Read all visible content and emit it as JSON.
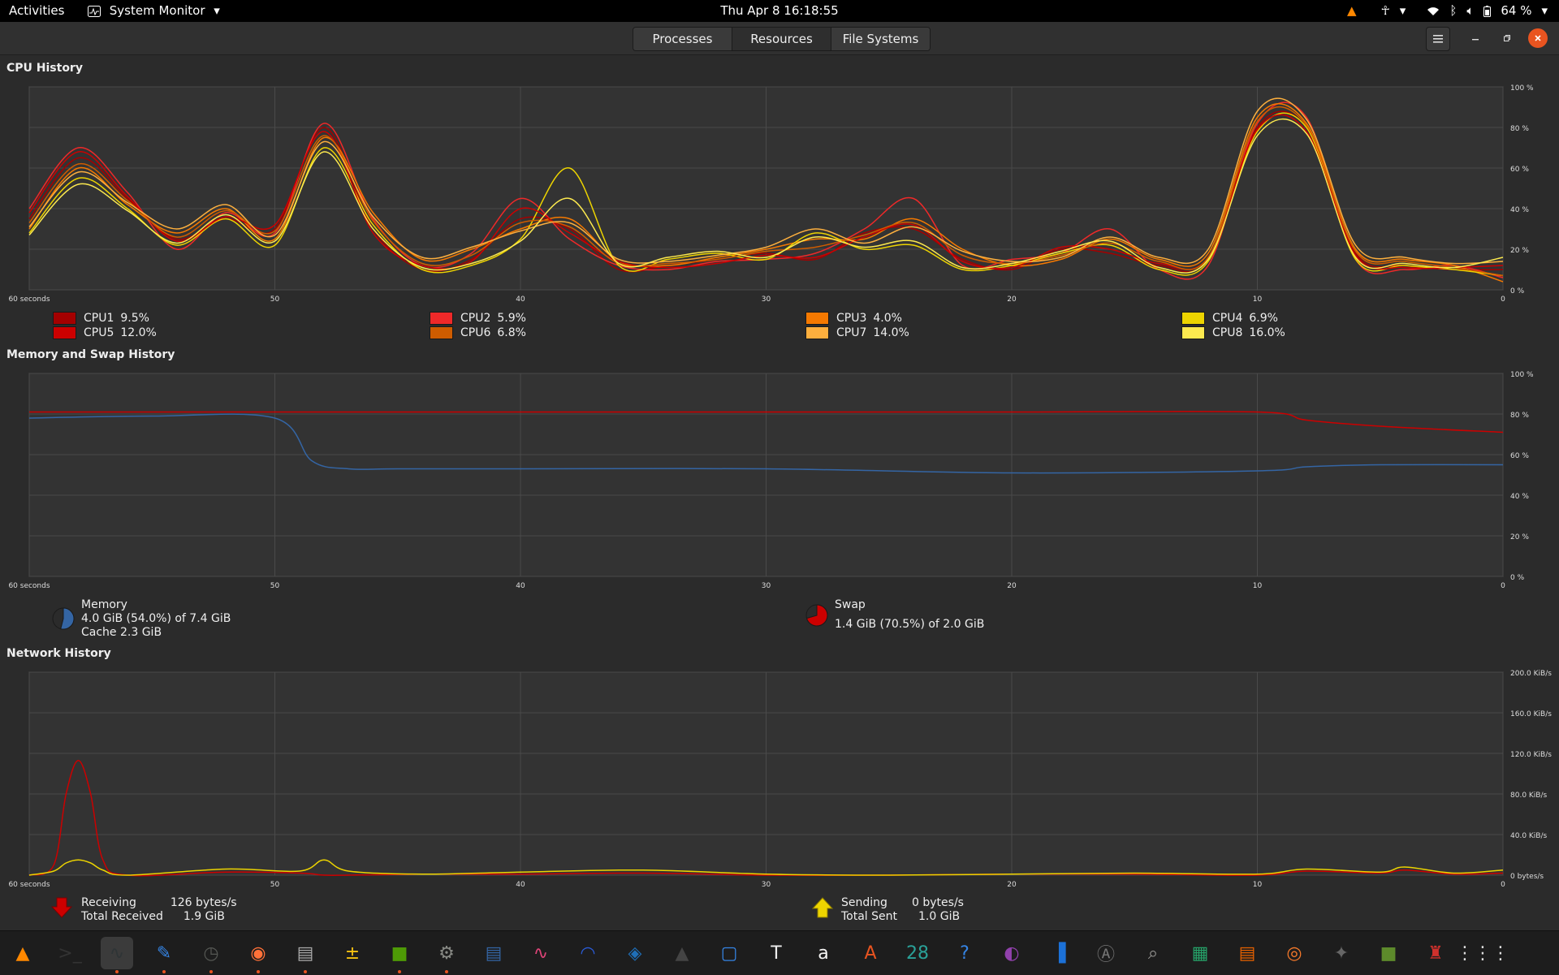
{
  "topbar": {
    "activities": "Activities",
    "app_name": "System Monitor",
    "clock": "Thu Apr 8  16:18:55",
    "battery": "64 %"
  },
  "tabs": [
    {
      "label": "Processes",
      "active": false
    },
    {
      "label": "Resources",
      "active": true
    },
    {
      "label": "File Systems",
      "active": false
    }
  ],
  "sections": {
    "cpu_title": "CPU History",
    "mem_title": "Memory and Swap History",
    "net_title": "Network History"
  },
  "x_ticks": [
    "60 seconds",
    "50",
    "40",
    "30",
    "20",
    "10",
    "0"
  ],
  "cpu_y_ticks": [
    "100 %",
    "80 %",
    "60 %",
    "40 %",
    "20 %",
    "0 %"
  ],
  "mem_y_ticks": [
    "100 %",
    "80 %",
    "60 %",
    "40 %",
    "20 %",
    "0 %"
  ],
  "net_y_ticks": [
    "200.0 KiB/s",
    "160.0 KiB/s",
    "120.0 KiB/s",
    "80.0 KiB/s",
    "40.0 KiB/s",
    "0 bytes/s"
  ],
  "cpus": [
    {
      "label": "CPU1",
      "value": "9.5%",
      "color": "#a40000"
    },
    {
      "label": "CPU2",
      "value": "5.9%",
      "color": "#ef2929"
    },
    {
      "label": "CPU3",
      "value": "4.0%",
      "color": "#f57900"
    },
    {
      "label": "CPU4",
      "value": "6.9%",
      "color": "#edd400"
    },
    {
      "label": "CPU5",
      "value": "12.0%",
      "color": "#cc0000"
    },
    {
      "label": "CPU6",
      "value": "6.8%",
      "color": "#ce5c00"
    },
    {
      "label": "CPU7",
      "value": "14.0%",
      "color": "#fcaf3e"
    },
    {
      "label": "CPU8",
      "value": "16.0%",
      "color": "#fce94f"
    }
  ],
  "memory": {
    "label": "Memory",
    "line1": "4.0 GiB (54.0%) of 7.4 GiB",
    "line2": "Cache 2.3 GiB",
    "fraction": 0.54,
    "color": "#3465a4"
  },
  "swap": {
    "label": "Swap",
    "line1": "1.4 GiB (70.5%) of 2.0 GiB",
    "fraction": 0.705,
    "color": "#cc0000"
  },
  "network": {
    "receiving_label": "Receiving",
    "receiving_value": "126 bytes/s",
    "total_received_label": "Total Received",
    "total_received_value": "1.9 GiB",
    "sending_label": "Sending",
    "sending_value": "0 bytes/s",
    "total_sent_label": "Total Sent",
    "total_sent_value": "1.0 GiB"
  },
  "chart_data": [
    {
      "type": "line",
      "title": "CPU History",
      "x": [
        60,
        58,
        56,
        54,
        52,
        50,
        48,
        46,
        44,
        42,
        40,
        38,
        36,
        34,
        32,
        30,
        28,
        26,
        24,
        22,
        20,
        18,
        16,
        14,
        12,
        10,
        8,
        6,
        4,
        2,
        0
      ],
      "xlim": [
        60,
        0
      ],
      "ylim": [
        0,
        100
      ],
      "series": [
        {
          "name": "CPU1",
          "color": "#a40000",
          "values": [
            35,
            65,
            45,
            25,
            35,
            30,
            80,
            30,
            10,
            15,
            35,
            30,
            10,
            12,
            15,
            18,
            15,
            28,
            30,
            15,
            10,
            20,
            18,
            12,
            15,
            80,
            80,
            18,
            12,
            10,
            10
          ]
        },
        {
          "name": "CPU2",
          "color": "#ef2929",
          "values": [
            40,
            70,
            48,
            20,
            38,
            28,
            82,
            35,
            12,
            18,
            45,
            25,
            12,
            10,
            14,
            15,
            18,
            30,
            45,
            12,
            15,
            18,
            30,
            10,
            12,
            82,
            85,
            15,
            10,
            12,
            6
          ]
        },
        {
          "name": "CPU3",
          "color": "#f57900",
          "values": [
            30,
            60,
            42,
            28,
            40,
            25,
            75,
            38,
            15,
            20,
            30,
            35,
            14,
            12,
            16,
            20,
            25,
            25,
            35,
            20,
            12,
            15,
            25,
            15,
            18,
            85,
            82,
            20,
            15,
            12,
            4
          ]
        },
        {
          "name": "CPU4",
          "color": "#edd400",
          "values": [
            28,
            55,
            40,
            22,
            35,
            22,
            70,
            32,
            10,
            12,
            25,
            60,
            12,
            15,
            18,
            15,
            28,
            20,
            22,
            10,
            12,
            18,
            22,
            10,
            14,
            78,
            80,
            15,
            12,
            10,
            7
          ]
        },
        {
          "name": "CPU5",
          "color": "#cc0000",
          "values": [
            38,
            68,
            46,
            24,
            36,
            32,
            78,
            28,
            12,
            14,
            40,
            28,
            14,
            11,
            13,
            17,
            16,
            26,
            32,
            14,
            11,
            21,
            20,
            13,
            16,
            79,
            78,
            17,
            11,
            11,
            12
          ]
        },
        {
          "name": "CPU6",
          "color": "#ce5c00",
          "values": [
            33,
            62,
            44,
            26,
            39,
            29,
            76,
            34,
            13,
            17,
            33,
            31,
            13,
            13,
            15,
            19,
            21,
            27,
            33,
            17,
            13,
            17,
            23,
            14,
            16,
            83,
            81,
            19,
            14,
            11,
            7
          ]
        },
        {
          "name": "CPU7",
          "color": "#fcaf3e",
          "values": [
            31,
            58,
            43,
            30,
            42,
            27,
            73,
            36,
            16,
            21,
            29,
            33,
            15,
            14,
            17,
            21,
            30,
            23,
            31,
            19,
            14,
            16,
            26,
            16,
            20,
            88,
            84,
            22,
            16,
            13,
            14
          ]
        },
        {
          "name": "CPU8",
          "color": "#fce94f",
          "values": [
            27,
            52,
            39,
            23,
            37,
            24,
            68,
            30,
            11,
            13,
            24,
            45,
            13,
            16,
            19,
            16,
            26,
            21,
            24,
            11,
            13,
            19,
            24,
            11,
            15,
            76,
            77,
            16,
            13,
            11,
            16
          ]
        }
      ]
    },
    {
      "type": "line",
      "title": "Memory and Swap History",
      "x": [
        60,
        55,
        50,
        48.5,
        47,
        45,
        40,
        30,
        20,
        10,
        8,
        5,
        0
      ],
      "xlim": [
        60,
        0
      ],
      "ylim": [
        0,
        100
      ],
      "series": [
        {
          "name": "Memory",
          "color": "#3465a4",
          "values": [
            78,
            79,
            78,
            57,
            53,
            53,
            53,
            53,
            51,
            52,
            54,
            55,
            55
          ]
        },
        {
          "name": "Swap",
          "color": "#cc0000",
          "values": [
            81,
            81,
            81,
            81,
            81,
            81,
            81,
            81,
            81,
            81,
            77,
            74,
            71
          ]
        }
      ]
    },
    {
      "type": "line",
      "title": "Network History",
      "x": [
        60,
        59,
        58.5,
        58,
        57.5,
        57,
        56,
        52,
        49,
        48,
        47,
        44,
        40,
        35,
        30,
        25,
        20,
        15,
        10,
        8,
        5,
        4,
        2,
        0
      ],
      "xlim": [
        60,
        0
      ],
      "ylim": [
        0,
        200
      ],
      "ylabel": "KiB/s",
      "series": [
        {
          "name": "Receiving",
          "color": "#cc0000",
          "values": [
            0,
            10,
            80,
            113,
            80,
            15,
            0,
            3,
            2,
            0,
            0,
            1,
            1,
            2,
            0,
            0,
            1,
            1,
            0,
            4,
            2,
            5,
            1,
            2
          ]
        },
        {
          "name": "Sending",
          "color": "#edd400",
          "values": [
            0,
            4,
            12,
            15,
            12,
            5,
            0,
            6,
            4,
            15,
            4,
            1,
            3,
            5,
            1,
            0,
            1,
            2,
            1,
            6,
            3,
            8,
            2,
            5
          ]
        }
      ]
    }
  ],
  "dock": [
    {
      "name": "vlc-icon",
      "color": "#ff8800",
      "glyph": "▲",
      "dot": false,
      "active": false
    },
    {
      "name": "terminal-icon",
      "color": "#333333",
      "glyph": ">_",
      "dot": false,
      "active": false
    },
    {
      "name": "system-monitor-icon",
      "color": "#2e3436",
      "glyph": "∿",
      "dot": true,
      "active": true
    },
    {
      "name": "text-editor-icon",
      "color": "#3584e4",
      "glyph": "✎",
      "dot": true,
      "active": false
    },
    {
      "name": "clock-icon",
      "color": "#555753",
      "glyph": "◷",
      "dot": true,
      "active": false
    },
    {
      "name": "firefox-icon",
      "color": "#ff7139",
      "glyph": "◉",
      "dot": true,
      "active": false
    },
    {
      "name": "files-icon",
      "color": "#aaaaaa",
      "glyph": "▤",
      "dot": true,
      "active": false
    },
    {
      "name": "calculator-icon",
      "color": "#f5c211",
      "glyph": "±",
      "dot": false,
      "active": false
    },
    {
      "name": "puzzle-icon",
      "color": "#4e9a06",
      "glyph": "■",
      "dot": true,
      "active": false
    },
    {
      "name": "settings-icon",
      "color": "#888a85",
      "glyph": "⚙",
      "dot": true,
      "active": false
    },
    {
      "name": "writer-icon",
      "color": "#3465a4",
      "glyph": "▤",
      "dot": false,
      "active": false
    },
    {
      "name": "waveform-icon",
      "color": "#dd4477",
      "glyph": "∿",
      "dot": false,
      "active": false
    },
    {
      "name": "audacity-icon",
      "color": "#2a5bd7",
      "glyph": "◠",
      "dot": false,
      "active": false
    },
    {
      "name": "virtualbox-icon",
      "color": "#1f6fb8",
      "glyph": "◈",
      "dot": false,
      "active": false
    },
    {
      "name": "inkscape-icon",
      "color": "#444444",
      "glyph": "▲",
      "dot": false,
      "active": false
    },
    {
      "name": "screenshot-icon",
      "color": "#3584e4",
      "glyph": "▢",
      "dot": false,
      "active": false
    },
    {
      "name": "typora-icon",
      "color": "#eeeeee",
      "glyph": "T",
      "dot": false,
      "active": false
    },
    {
      "name": "document-icon",
      "color": "#f6f5f4",
      "glyph": "a",
      "dot": false,
      "active": false
    },
    {
      "name": "software-center-icon",
      "color": "#e95420",
      "glyph": "A",
      "dot": false,
      "active": false
    },
    {
      "name": "calendar-icon",
      "color": "#2aa198",
      "glyph": "28",
      "dot": false,
      "active": false
    },
    {
      "name": "help-icon",
      "color": "#3584e4",
      "glyph": "?",
      "dot": false,
      "active": false
    },
    {
      "name": "tweaks-icon",
      "color": "#9141ac",
      "glyph": "◐",
      "dot": false,
      "active": false
    },
    {
      "name": "book-icon",
      "color": "#1c71d8",
      "glyph": "▐",
      "dot": false,
      "active": false
    },
    {
      "name": "update-manager-icon",
      "color": "#777777",
      "glyph": "Ⓐ",
      "dot": false,
      "active": false
    },
    {
      "name": "image-viewer-icon",
      "color": "#9a9996",
      "glyph": "⌕",
      "dot": false,
      "active": false
    },
    {
      "name": "calc-spreadsheet-icon",
      "color": "#26a269",
      "glyph": "▦",
      "dot": false,
      "active": false
    },
    {
      "name": "impress-icon",
      "color": "#e66100",
      "glyph": "▤",
      "dot": false,
      "active": false
    },
    {
      "name": "blender-icon",
      "color": "#f5792a",
      "glyph": "◎",
      "dot": false,
      "active": false
    },
    {
      "name": "gimp-icon",
      "color": "#666666",
      "glyph": "✦",
      "dot": false,
      "active": false
    },
    {
      "name": "minecraft-icon",
      "color": "#5d8a2b",
      "glyph": "■",
      "dot": false,
      "active": false
    },
    {
      "name": "mario-icon",
      "color": "#d0312d",
      "glyph": "♜",
      "dot": false,
      "active": false
    },
    {
      "name": "app-grid-icon",
      "color": "#dddddd",
      "glyph": "⋮⋮⋮",
      "dot": false,
      "active": false
    }
  ]
}
